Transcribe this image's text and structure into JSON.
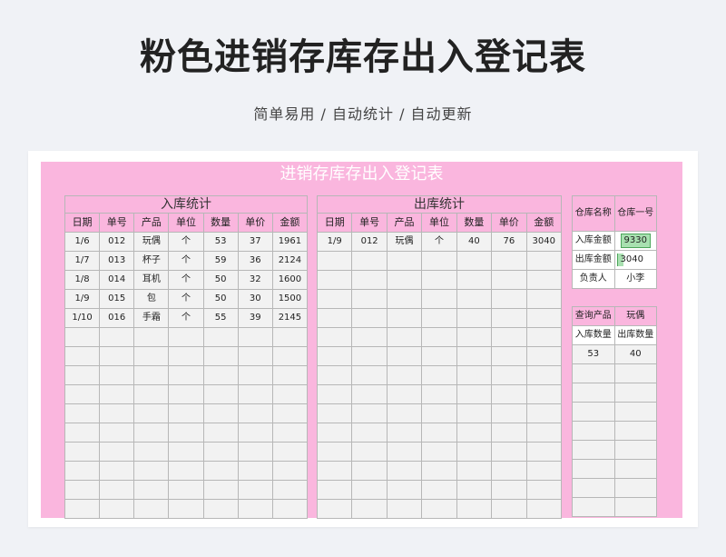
{
  "page": {
    "title": "粉色进销存库存出入登记表",
    "subtitle": "简单易用 / 自动统计 / 自动更新"
  },
  "sheet": {
    "title": "进销存库存出入登记表"
  },
  "inbound": {
    "title": "入库统计",
    "headers": [
      "日期",
      "单号",
      "产品",
      "单位",
      "数量",
      "单价",
      "金额"
    ],
    "rows": [
      [
        "1/6",
        "012",
        "玩偶",
        "个",
        "53",
        "37",
        "1961"
      ],
      [
        "1/7",
        "013",
        "杯子",
        "个",
        "59",
        "36",
        "2124"
      ],
      [
        "1/8",
        "014",
        "耳机",
        "个",
        "50",
        "32",
        "1600"
      ],
      [
        "1/9",
        "015",
        "包",
        "个",
        "50",
        "30",
        "1500"
      ],
      [
        "1/10",
        "016",
        "手霜",
        "个",
        "55",
        "39",
        "2145"
      ]
    ]
  },
  "outbound": {
    "title": "出库统计",
    "headers": [
      "日期",
      "单号",
      "产品",
      "单位",
      "数量",
      "单价",
      "金额"
    ],
    "rows": [
      [
        "1/9",
        "012",
        "玩偶",
        "个",
        "40",
        "76",
        "3040"
      ]
    ]
  },
  "warehouse": {
    "name_label": "仓库名称",
    "name_value": "仓库一号",
    "in_amount_label": "入库金额",
    "in_amount_value": "9330",
    "in_amount_fill": 1.0,
    "out_amount_label": "出库金额",
    "out_amount_value": "3040",
    "out_amount_fill": 0.33,
    "manager_label": "负责人",
    "manager_value": "小李"
  },
  "query": {
    "product_label": "查询产品",
    "product_value": "玩偶",
    "in_qty_label": "入库数量",
    "out_qty_label": "出库数量",
    "in_qty_value": "53",
    "out_qty_value": "40"
  },
  "colors": {
    "sheet_pink": "#fab6de",
    "cell_gray": "#f2f2f2",
    "grid": "#b7b7b7",
    "bar_green": "#a8e0b0"
  }
}
